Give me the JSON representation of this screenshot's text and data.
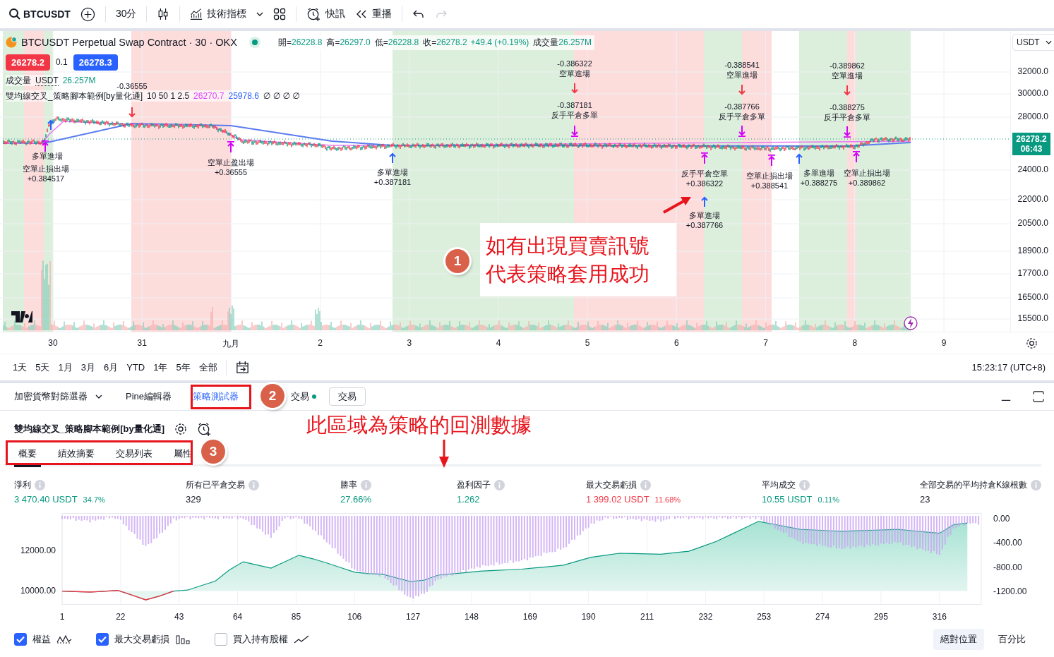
{
  "toolbar": {
    "symbol": "BTCUSDT",
    "interval": "30分",
    "indicators": "技術指標",
    "alert": "快訊",
    "replay": "重播",
    "redo_disabled": true
  },
  "chart": {
    "title": "BTCUSDT Perpetual Swap Contract · 30 · OKX",
    "ohlc": [
      {
        "label": "開=",
        "value": "26228.8"
      },
      {
        "label": "高=",
        "value": "26297.0"
      },
      {
        "label": "低=",
        "value": "26228.8"
      },
      {
        "label": "收=",
        "value": "26278.2"
      }
    ],
    "change": "+49.4 (+0.19%)",
    "volume_label": "成交量",
    "volume_value": "26.257M",
    "bid": "26278.2",
    "spread": "0.1",
    "ask": "26278.3",
    "volume_row": {
      "label": "成交量",
      "unit": "USDT",
      "value": "26.257M"
    },
    "strategy_row": {
      "name": "雙均線交叉_策略腳本範例[by量化通]",
      "params": "10 50 1 2.5",
      "fast": "26270.7",
      "slow": "25978.6",
      "empty": "∅ ∅ ∅ ∅"
    },
    "currency": "USDT",
    "last_price": "26278.2",
    "countdown": "06:43",
    "price_axis": [
      "32000.0",
      "30000.0",
      "28000.0",
      "24000.0",
      "22000.0",
      "20500.0",
      "18900.0",
      "17700.0",
      "16500.0",
      "15500.0"
    ],
    "time_axis": [
      "30",
      "31",
      "九月",
      "2",
      "3",
      "4",
      "5",
      "6",
      "7",
      "8",
      "9"
    ],
    "signals": [
      {
        "kind": "short_entry",
        "value": "-0.36555"
      },
      {
        "kind": "short_entry",
        "label": "空單進場",
        "value": "-0.386322"
      },
      {
        "kind": "reverse_close_long",
        "label": "反手平倉多單",
        "value": "-0.387181"
      },
      {
        "kind": "short_entry",
        "label": "空單進場",
        "value": "-0.388541"
      },
      {
        "kind": "reverse_close_long",
        "label": "反手平倉多單",
        "value": "-0.387766"
      },
      {
        "kind": "short_entry",
        "label": "空單進場",
        "value": "-0.389862"
      },
      {
        "kind": "reverse_close_long",
        "label": "反手平倉多單",
        "value": "-0.388275"
      },
      {
        "kind": "long_entry",
        "label": "多單進場"
      },
      {
        "kind": "short_exit",
        "label": "空單止損出場",
        "value": "+0.384517"
      },
      {
        "kind": "short_exit",
        "label": "空單止盈出場",
        "value": "+0.36555"
      },
      {
        "kind": "long_entry",
        "label": "多單進場",
        "value": "+0.387181"
      },
      {
        "kind": "short_exit",
        "label": "反手平倉空單",
        "value": "+0.386322"
      },
      {
        "kind": "long_entry",
        "label": "多單進場",
        "value": "+0.387766"
      },
      {
        "kind": "short_exit",
        "label": "空單止損出場",
        "value": "+0.388541"
      },
      {
        "kind": "long_entry",
        "label": "多單進場",
        "value": "+0.388275"
      },
      {
        "kind": "short_exit",
        "label": "空單止損出場",
        "value": "+0.389862"
      }
    ],
    "callout": [
      "如有出現買賣訊號",
      "代表策略套用成功"
    ],
    "callout_badge": "1"
  },
  "timeframes": [
    "1天",
    "5天",
    "1月",
    "3月",
    "6月",
    "YTD",
    "1年",
    "5年",
    "全部"
  ],
  "clock": "15:23:17 (UTC+8)",
  "panel": {
    "tabs": [
      {
        "label": "加密貨幣對篩選器",
        "kind": "dropdown",
        "selected": false
      },
      {
        "label": "Pine編輯器",
        "kind": "tab",
        "selected": false
      },
      {
        "label": "策略測試器",
        "kind": "tab",
        "selected": true
      },
      {
        "label": "交易",
        "kind": "status",
        "selected": false
      },
      {
        "label": "交易",
        "kind": "button",
        "selected": false
      }
    ],
    "tab_badge": "2",
    "note": "此區域為策略的回測數據",
    "strategy_name": "雙均線交叉_策略腳本範例[by量化通]",
    "subtabs": [
      {
        "label": "概要",
        "selected": true
      },
      {
        "label": "績效摘要",
        "selected": false
      },
      {
        "label": "交易列表",
        "selected": false
      },
      {
        "label": "屬性",
        "selected": false
      }
    ],
    "subtab_badge": "3",
    "stats": [
      {
        "label": "淨利",
        "value": "3 470.40 USDT",
        "percent": "34.7%",
        "color": "#089981"
      },
      {
        "label": "所有已平倉交易",
        "value": "329",
        "color": "#131722"
      },
      {
        "label": "勝率",
        "value": "27.66%",
        "color": "#089981"
      },
      {
        "label": "盈利因子",
        "value": "1.262",
        "color": "#089981"
      },
      {
        "label": "最大交易虧損",
        "value": "1 399.02 USDT",
        "percent": "11.68%",
        "color": "#f23645"
      },
      {
        "label": "平均成交",
        "value": "10.55 USDT",
        "percent": "0.11%",
        "color": "#089981"
      },
      {
        "label": "全部交易的平均持倉K線根數",
        "value": "23",
        "color": "#131722"
      }
    ],
    "equity_chart": {
      "chart_data": {
        "type": "area",
        "x": [
          1,
          6,
          11,
          16,
          21,
          26,
          31,
          36,
          41,
          46,
          51,
          56,
          61,
          66,
          71,
          76,
          81,
          86,
          91,
          96,
          101,
          106,
          111,
          116,
          121,
          126,
          131,
          136,
          141,
          146,
          151,
          156,
          161,
          166,
          171,
          176,
          181,
          186,
          191,
          196,
          201,
          206,
          211,
          216,
          221,
          226,
          231,
          236,
          241,
          246,
          251,
          256,
          261,
          266,
          271,
          276,
          281,
          286,
          291,
          296,
          301,
          306,
          311,
          316,
          321,
          326
        ],
        "values": [
          10000,
          9975,
          9950,
          9990,
          10030,
          9800,
          9560,
          9750,
          10000,
          10050,
          10275,
          10500,
          11056,
          11468,
          11309,
          11150,
          11475,
          11800,
          11621,
          11411,
          11179,
          10946,
          10878,
          10850,
          10662,
          10475,
          10550,
          10800,
          10867,
          10933,
          11000,
          11033,
          11067,
          11100,
          11167,
          11233,
          11300,
          11500,
          11700,
          11800,
          11900,
          11883,
          11867,
          11850,
          11925,
          12000,
          12250,
          12500,
          12833,
          13167,
          13500,
          13367,
          13233,
          13100,
          13067,
          13033,
          13000,
          13025,
          13050,
          13075,
          13100,
          13033,
          12967,
          12900,
          13329,
          13414
        ],
        "xlim": [
          1,
          331
        ],
        "ylim": [
          9330,
          13900
        ],
        "grid": true,
        "xticks": [
          1,
          22,
          43,
          64,
          85,
          106,
          127,
          148,
          169,
          190,
          211,
          232,
          253,
          274,
          295,
          316
        ],
        "yticks": [
          {
            "value": 12000,
            "label": "12000.00"
          },
          {
            "value": 10000,
            "label": "10000.00"
          }
        ]
      }
    },
    "drawdown_axis": [
      "0.00",
      "-400.00",
      "-800.00",
      "-1200.00"
    ],
    "legend": [
      {
        "label": "權益",
        "checked": true,
        "kind": "wave"
      },
      {
        "label": "最大交易虧損",
        "checked": true,
        "kind": "bars"
      },
      {
        "label": "買入持有股權",
        "checked": false,
        "kind": "line"
      }
    ],
    "scale": [
      {
        "label": "絕對位置",
        "selected": true
      },
      {
        "label": "百分比",
        "selected": false
      }
    ]
  }
}
